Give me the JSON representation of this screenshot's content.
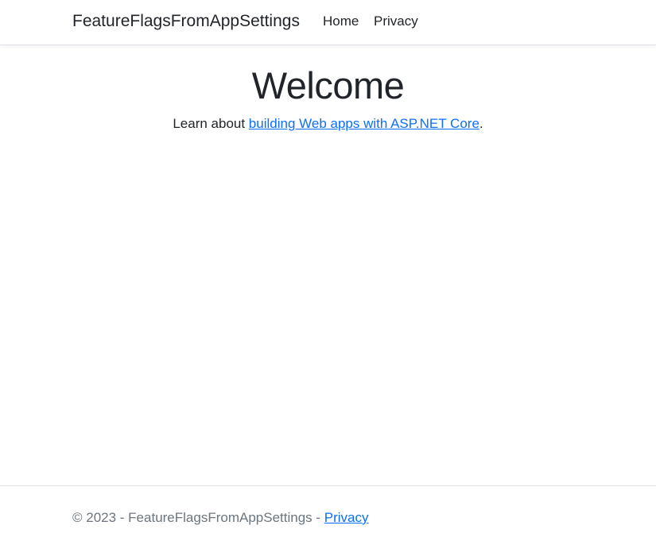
{
  "header": {
    "brand": "FeatureFlagsFromAppSettings",
    "nav": {
      "home": "Home",
      "privacy": "Privacy"
    }
  },
  "main": {
    "title": "Welcome",
    "learn_prefix": "Learn about ",
    "learn_link": "building Web apps with ASP.NET Core",
    "learn_suffix": "."
  },
  "footer": {
    "copyright": "© 2023 - FeatureFlagsFromAppSettings - ",
    "privacy_link": "Privacy"
  },
  "colors": {
    "link": "#0d6efd",
    "text": "#212529",
    "muted": "#6c757d",
    "border": "#dee2e6"
  }
}
